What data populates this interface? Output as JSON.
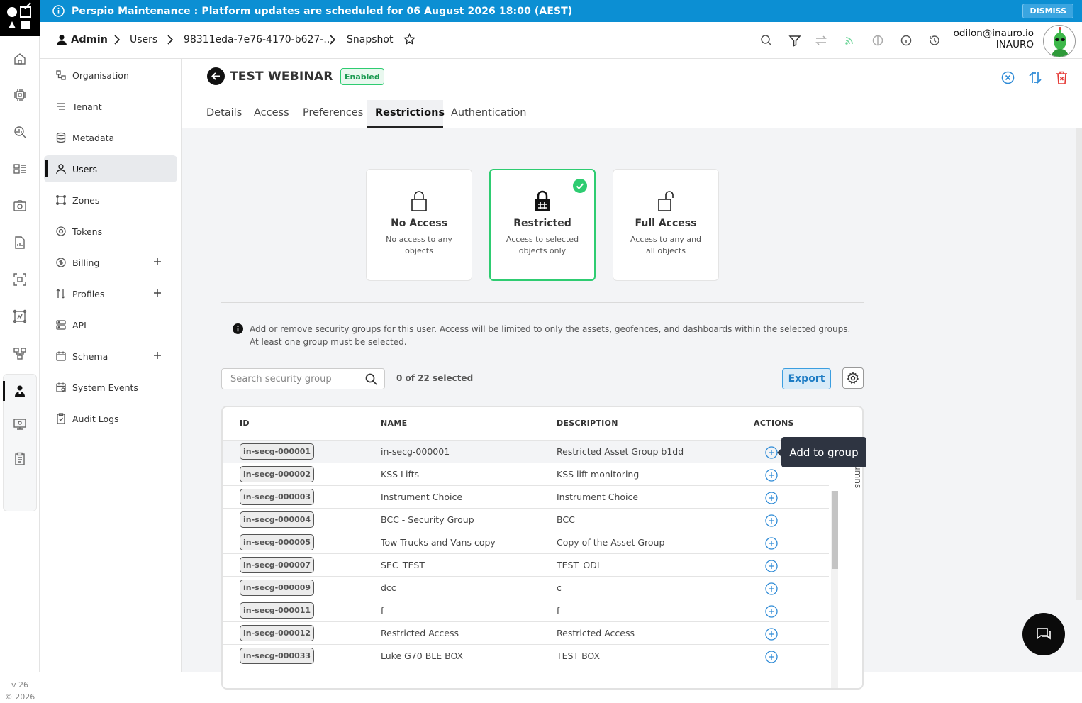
{
  "banner": {
    "text": "Perspio Maintenance : Platform updates are scheduled for 06 August 2026 18:00 (AEST)",
    "dismiss_label": "DISMISS",
    "color": "#0c8fd3"
  },
  "breadcrumb": {
    "items": [
      "Admin",
      "Users",
      "98311eda-7e76-4170-b627-...",
      "Snapshot"
    ]
  },
  "user": {
    "email": "odilon@inauro.io",
    "org": "INAURO"
  },
  "rail": {
    "icons": [
      "home-icon",
      "chip-icon",
      "search-chart-icon",
      "dashboard-icon",
      "camera-icon",
      "report-icon",
      "scan-icon",
      "fleet-icon",
      "hierarchy-icon",
      "admin-icon",
      "device-icon",
      "clipboard-icon"
    ],
    "version": "v 26",
    "copyright": "© 2026"
  },
  "sidebar": {
    "items": [
      {
        "label": "Organisation",
        "icon": "organisation-icon"
      },
      {
        "label": "Tenant",
        "icon": "tenant-icon"
      },
      {
        "label": "Metadata",
        "icon": "database-icon"
      },
      {
        "label": "Users",
        "icon": "user-icon",
        "active": true
      },
      {
        "label": "Zones",
        "icon": "zones-icon"
      },
      {
        "label": "Tokens",
        "icon": "tokens-icon"
      },
      {
        "label": "Billing",
        "icon": "billing-icon",
        "expandable": true
      },
      {
        "label": "Profiles",
        "icon": "profiles-icon",
        "expandable": true
      },
      {
        "label": "API",
        "icon": "api-icon"
      },
      {
        "label": "Schema",
        "icon": "schema-icon",
        "expandable": true
      },
      {
        "label": "System Events",
        "icon": "calendar-icon"
      },
      {
        "label": "Audit Logs",
        "icon": "audit-icon"
      }
    ]
  },
  "page": {
    "title": "TEST WEBINAR",
    "status": "Enabled",
    "tabs": [
      "Details",
      "Access",
      "Preferences",
      "Restrictions",
      "Authentication"
    ],
    "active_tab": "Restrictions"
  },
  "access_options": [
    {
      "title": "No Access",
      "desc": "No access to any objects",
      "icon": "lock-icon",
      "selected": false
    },
    {
      "title": "Restricted",
      "desc": "Access to selected objects only",
      "icon": "restricted-lock-icon",
      "selected": true
    },
    {
      "title": "Full Access",
      "desc": "Access to any and all objects",
      "icon": "unlock-icon",
      "selected": false
    }
  ],
  "info_text": "Add or remove security groups for this user. Access will be limited to only the assets, geofences, and dashboards within the selected groups. At least one group must be selected.",
  "search": {
    "placeholder": "Search security group"
  },
  "selection_count": "0 of 22 selected",
  "export_label": "Export",
  "table": {
    "headers": [
      "ID",
      "NAME",
      "DESCRIPTION",
      "ACTIONS"
    ],
    "rows": [
      {
        "id": "in-secg-000001",
        "name": "in-secg-000001",
        "desc": "Restricted Asset Group b1dd"
      },
      {
        "id": "in-secg-000002",
        "name": "KSS Lifts",
        "desc": "KSS lift monitoring"
      },
      {
        "id": "in-secg-000003",
        "name": "Instrument Choice",
        "desc": "Instrument Choice"
      },
      {
        "id": "in-secg-000004",
        "name": "BCC - Security Group",
        "desc": "BCC"
      },
      {
        "id": "in-secg-000005",
        "name": "Tow Trucks and Vans copy",
        "desc": "Copy of the Asset Group"
      },
      {
        "id": "in-secg-000007",
        "name": "SEC_TEST",
        "desc": "TEST_ODI"
      },
      {
        "id": "in-secg-000009",
        "name": "dcc",
        "desc": "c"
      },
      {
        "id": "in-secg-000011",
        "name": "f",
        "desc": "f"
      },
      {
        "id": "in-secg-000012",
        "name": "Restricted Access",
        "desc": "Restricted Access"
      },
      {
        "id": "in-secg-000033",
        "name": "Luke G70 BLE BOX",
        "desc": "TEST BOX"
      }
    ],
    "columns_tab": "Columns"
  },
  "tooltip": "Add to group",
  "colors": {
    "accent": "#3b9ee0",
    "success": "#2ecc71",
    "danger": "#e53935"
  }
}
